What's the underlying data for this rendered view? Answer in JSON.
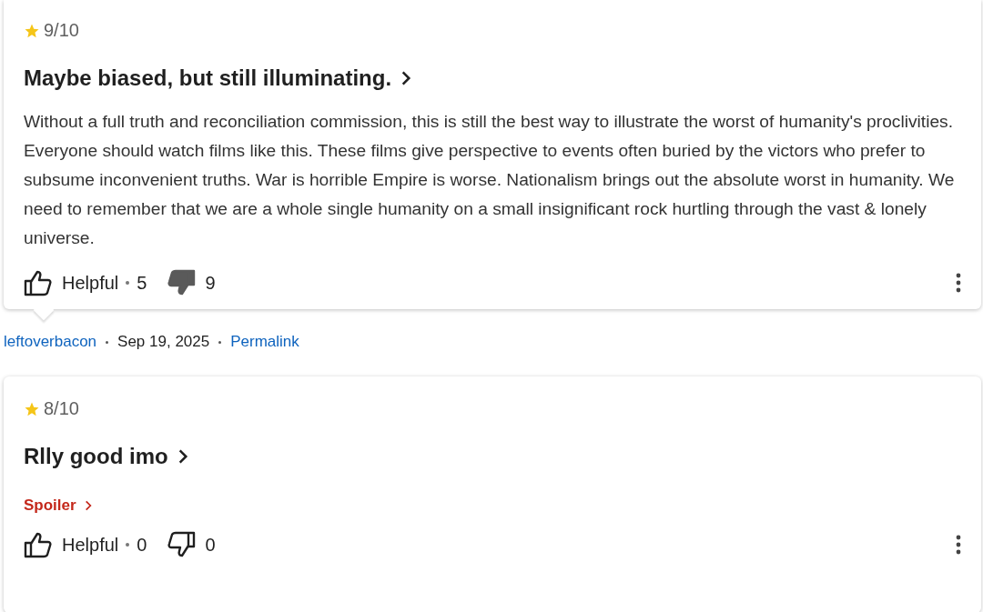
{
  "reviews": [
    {
      "rating": "9/10",
      "title": "Maybe biased, but still illuminating.",
      "body": "Without a full truth and reconciliation commission, this is still the best way to illustrate the worst of humanity's proclivities. Everyone should watch films like this. These films give perspective to events often buried by the victors who prefer to subsume inconvenient truths. War is horrible Empire is worse. Nationalism brings out the absolute worst in humanity. We need to remember that we are a whole single humanity on a small insignificant rock hurtling through the vast & lonely universe.",
      "helpful_label": "Helpful",
      "helpful_count": "5",
      "unhelpful_count": "9",
      "unhelpful_selected": true,
      "author": "leftoverbacon",
      "date": "Sep 19, 2025",
      "permalink": "Permalink"
    },
    {
      "rating": "8/10",
      "title": "Rlly good imo",
      "spoiler": "Spoiler",
      "helpful_label": "Helpful",
      "helpful_count": "0",
      "unhelpful_count": "0",
      "unhelpful_selected": false
    }
  ]
}
